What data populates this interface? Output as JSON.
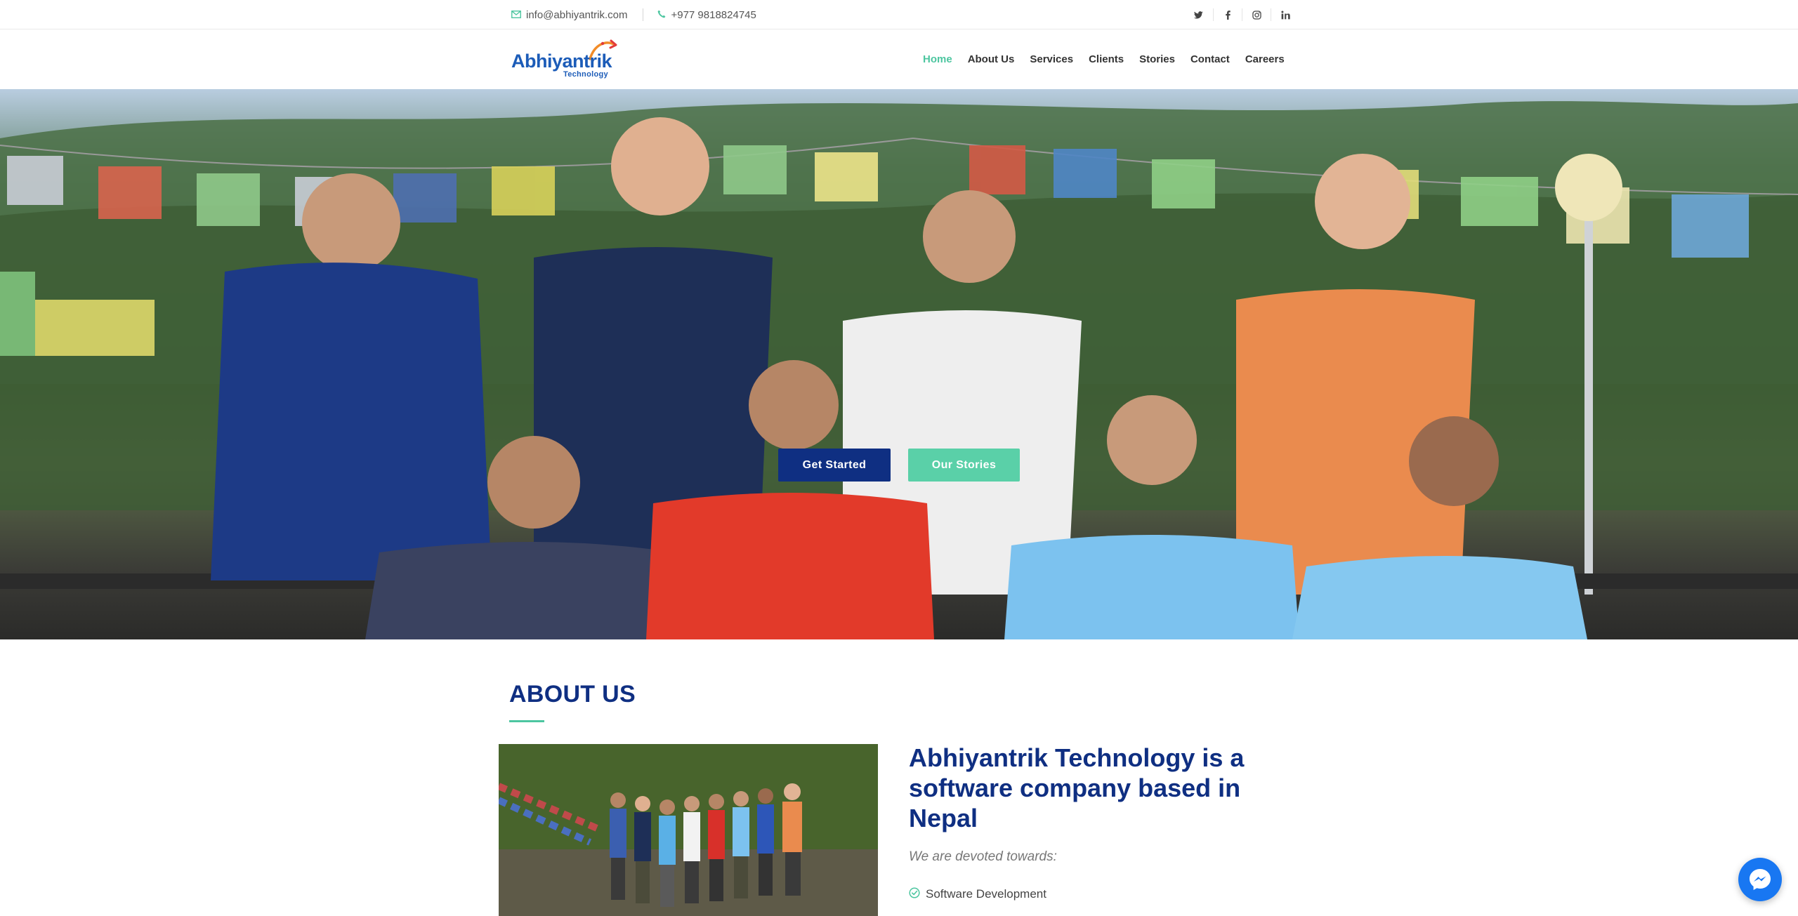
{
  "topbar": {
    "email": "info@abhiyantrik.com",
    "phone": "+977 9818824745",
    "email_icon": "envelope-icon",
    "phone_icon": "phone-icon",
    "social": [
      {
        "name": "twitter",
        "glyph": "𝕥"
      },
      {
        "name": "facebook",
        "glyph": "f"
      },
      {
        "name": "instagram",
        "glyph": "◎"
      },
      {
        "name": "linkedin",
        "glyph": "in"
      }
    ]
  },
  "header": {
    "logo_word": "Abhiyantrik",
    "logo_sub": "Technology",
    "nav": [
      {
        "label": "Home",
        "active": true
      },
      {
        "label": "About Us",
        "active": false
      },
      {
        "label": "Services",
        "active": false
      },
      {
        "label": "Clients",
        "active": false
      },
      {
        "label": "Stories",
        "active": false
      },
      {
        "label": "Contact",
        "active": false
      },
      {
        "label": "Careers",
        "active": false
      }
    ]
  },
  "hero": {
    "primary_button": "Get Started",
    "secondary_button": "Our Stories"
  },
  "about": {
    "title": "ABOUT US",
    "heading": "Abhiyantrik Technology is a software company based in Nepal",
    "lead": "We are devoted towards:",
    "items": [
      "Software Development"
    ]
  },
  "colors": {
    "brand_blue": "#0f2f82",
    "accent_green": "#4dc6a0",
    "logo_blue": "#1c5cb8",
    "messenger_blue": "#1877f2"
  }
}
